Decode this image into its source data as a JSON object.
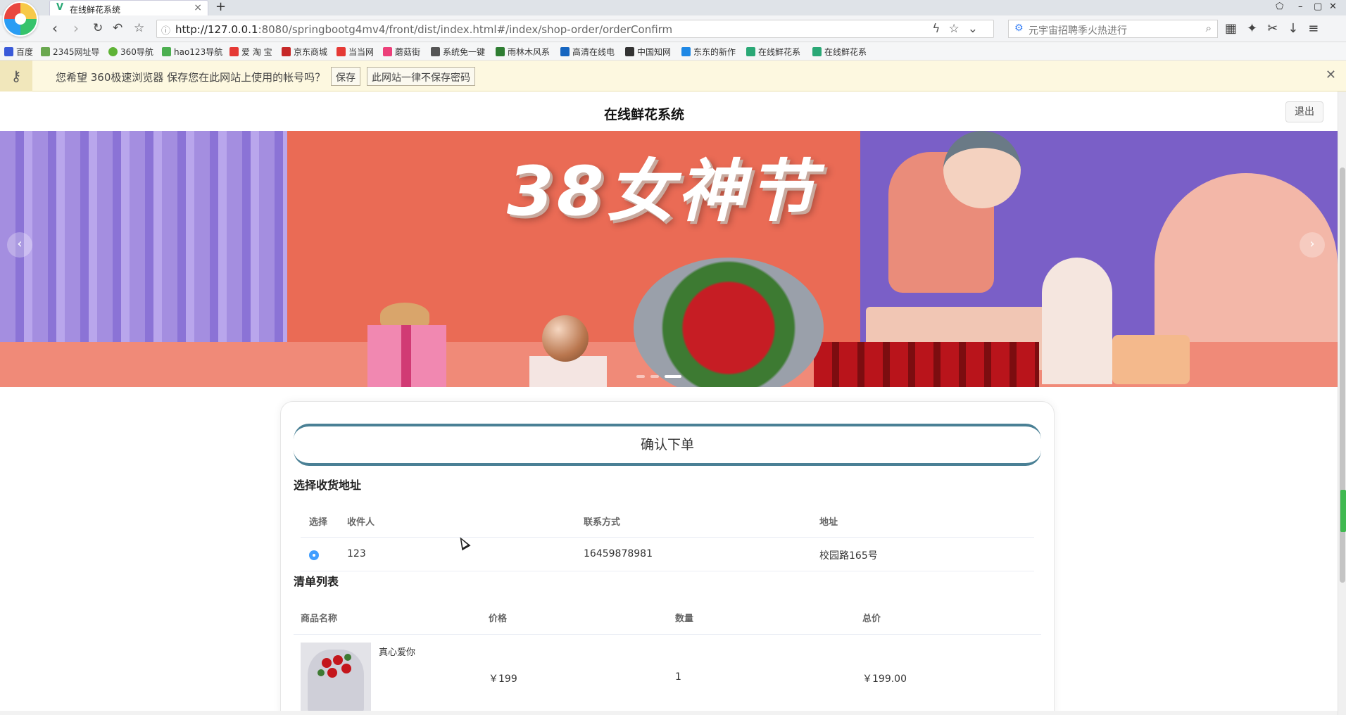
{
  "browser": {
    "tab_title": "在线鲜花系统",
    "url_host": "http://127.0.0.1",
    "url_rest": ":8080/springbootg4mv4/front/dist/index.html#/index/shop-order/orderConfirm",
    "search_placeholder": "元宇宙招聘季火热进行",
    "bookmarks": [
      "百度",
      "2345网址导",
      "360导航",
      "hao123导航",
      "爱 淘 宝",
      "京东商城",
      "当当网",
      "蘑菇街",
      "系统免一键",
      "雨林木风系",
      "高清在线电",
      "中国知网",
      "东东的新作",
      "在线鲜花系",
      "在线鲜花系"
    ],
    "password_prompt": "您希望 360极速浏览器 保存您在此网站上使用的帐号吗？",
    "save_label": "保存",
    "never_label": "此网站一律不保存密码"
  },
  "header": {
    "site_title": "在线鲜花系统",
    "logout_label": "退出"
  },
  "banner": {
    "title": "38女神节",
    "slide_count": 3,
    "active_slide": 3
  },
  "order": {
    "title": "确认下单",
    "address_section": "选择收货地址",
    "address_columns": [
      "选择",
      "收件人",
      "联系方式",
      "地址"
    ],
    "address_rows": [
      {
        "recipient": "123",
        "phone": "16459878981",
        "address": "校园路165号",
        "selected": true
      }
    ],
    "items_section": "清单列表",
    "item_columns": [
      "商品名称",
      "价格",
      "数量",
      "总价"
    ],
    "items": [
      {
        "name": "真心爱你",
        "price": "￥199",
        "quantity": "1",
        "total": "￥199.00"
      }
    ]
  },
  "colors": {
    "accent_border": "#4a8095",
    "radio_selected": "#409eff",
    "password_bar_bg": "#fdf8e0"
  }
}
